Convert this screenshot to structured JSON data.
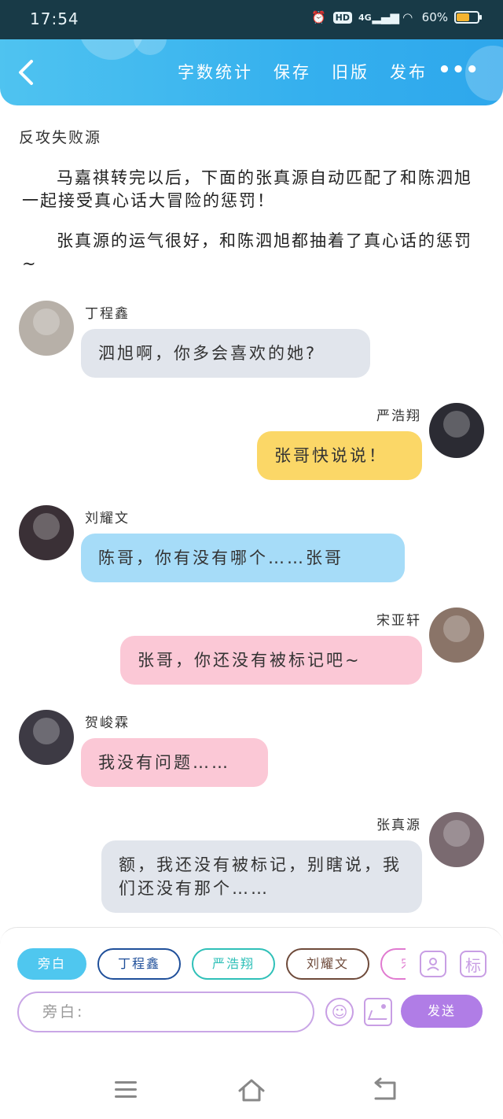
{
  "status_bar": {
    "time": "17:54",
    "network": "4G",
    "hd_label": "HD",
    "battery": "60%"
  },
  "toolbar": {
    "back_icon": "back-chevron-icon",
    "actions": [
      "字数统计",
      "保存",
      "旧版",
      "发布"
    ],
    "more_label": "•••"
  },
  "story": {
    "title": "反攻失败源",
    "paragraphs": [
      "马嘉祺转完以后，下面的张真源自动匹配了和陈泗旭一起接受真心话大冒险的惩罚！",
      "张真源的运气很好，和陈泗旭都抽着了真心话的惩罚~"
    ]
  },
  "messages": [
    {
      "side": "left",
      "name": "丁程鑫",
      "text": "泗旭啊，你多会喜欢的她?",
      "bubble_color": "#e1e5ec",
      "avatar_color": "#b7b0a8"
    },
    {
      "side": "right",
      "name": "严浩翔",
      "text": "张哥快说说！",
      "bubble_color": "#fbd767",
      "avatar_color": "#2b2b33"
    },
    {
      "side": "left",
      "name": "刘耀文",
      "text": "陈哥，你有没有哪个……张哥",
      "bubble_color": "#a6dcf8",
      "avatar_color": "#3a3036"
    },
    {
      "side": "right",
      "name": "宋亚轩",
      "text": "张哥，你还没有被标记吧~",
      "bubble_color": "#fbc8d6",
      "avatar_color": "#8a7468"
    },
    {
      "side": "left",
      "name": "贺峻霖",
      "text": "我没有问题……",
      "bubble_color": "#fbc8d6",
      "avatar_color": "#3d3a44"
    },
    {
      "side": "right",
      "name": "张真源",
      "text": "额，我还没有被标记，别瞎说，我们还没有那个……",
      "bubble_color": "#e1e5ec",
      "avatar_color": "#7a6a70"
    }
  ],
  "roles": [
    {
      "label": "旁白",
      "color": "#4fc7ef"
    },
    {
      "label": "丁程鑫",
      "color": "#1f4f9a"
    },
    {
      "label": "严浩翔",
      "color": "#2fc0b8"
    },
    {
      "label": "刘耀文",
      "color": "#6e4a3a"
    },
    {
      "label": "宋亚轩",
      "color": "#e07ad0"
    }
  ],
  "tools": {
    "role_icon": "person-card-icon",
    "mark_label": "标"
  },
  "composer": {
    "placeholder": "旁白:",
    "emoji_icon": "emoji-icon",
    "image_icon": "image-icon",
    "send_label": "发送"
  },
  "nav": {
    "menu_icon": "menu-icon",
    "home_icon": "home-icon",
    "back_icon": "back-icon"
  }
}
